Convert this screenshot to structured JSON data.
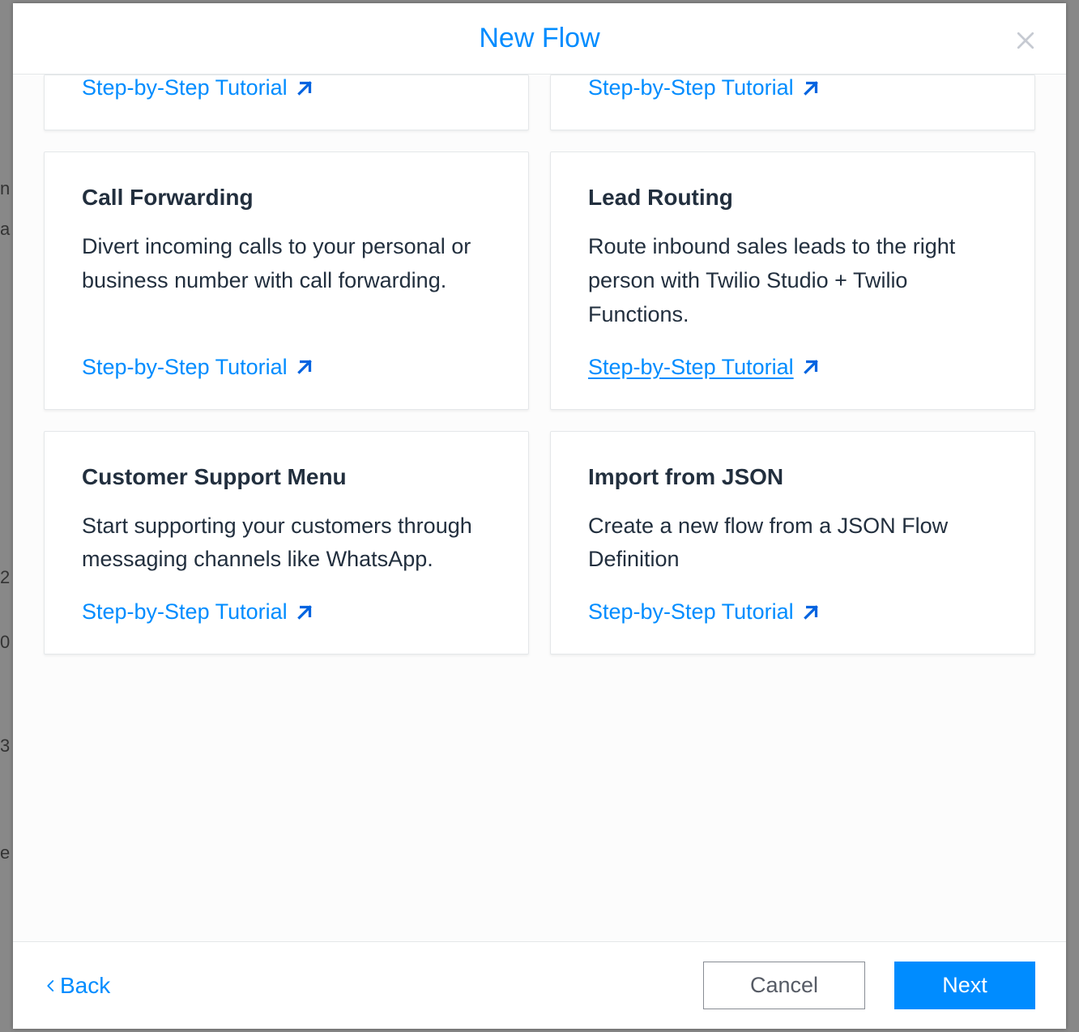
{
  "modal": {
    "title": "New Flow",
    "tutorial_label": "Step-by-Step Tutorial",
    "cards": [
      {
        "title": "",
        "desc": ""
      },
      {
        "title": "",
        "desc": ""
      },
      {
        "title": "Call Forwarding",
        "desc": "Divert incoming calls to your personal or business number with call forwarding."
      },
      {
        "title": "Lead Routing",
        "desc": "Route inbound sales leads to the right person with Twilio Studio + Twilio Functions."
      },
      {
        "title": "Customer Support Menu",
        "desc": "Start supporting your customers through messaging channels like WhatsApp."
      },
      {
        "title": "Import from JSON",
        "desc": "Create a new flow from a JSON Flow Definition"
      }
    ],
    "footer": {
      "back": "Back",
      "cancel": "Cancel",
      "next": "Next"
    }
  }
}
